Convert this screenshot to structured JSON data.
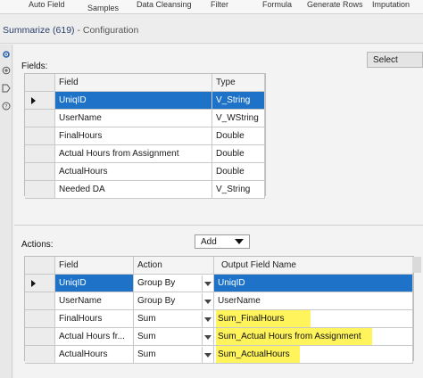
{
  "ribbon": {
    "items": [
      "Auto Field",
      "Samples",
      "Data Cleansing",
      "Filter",
      "Formula",
      "Generate Rows",
      "Imputation"
    ]
  },
  "header": {
    "tool": "Summarize (619)",
    "subtitle": " - Configuration"
  },
  "select_button": "Select",
  "fields": {
    "label": "Fields:",
    "columns": [
      "Field",
      "Type"
    ],
    "rows": [
      {
        "field": "UniqID",
        "type": "V_String",
        "selected": true
      },
      {
        "field": "UserName",
        "type": "V_WString"
      },
      {
        "field": "FinalHours",
        "type": "Double"
      },
      {
        "field": "Actual Hours from Assignment",
        "type": "Double"
      },
      {
        "field": "ActualHours",
        "type": "Double"
      },
      {
        "field": "Needed DA",
        "type": "V_String"
      }
    ]
  },
  "actions": {
    "label": "Actions:",
    "add_button": "Add",
    "columns": [
      "Field",
      "Action",
      "Output Field Name"
    ],
    "rows": [
      {
        "field": "UniqID",
        "action": "Group By",
        "output": "UniqID",
        "selected": true
      },
      {
        "field": "UserName",
        "action": "Group By",
        "output": "UserName"
      },
      {
        "field": "FinalHours",
        "action": "Sum",
        "output": "Sum_FinalHours",
        "highlight": true
      },
      {
        "field": "Actual Hours fr...",
        "action": "Sum",
        "output": "Sum_Actual Hours from Assignment",
        "highlight": true
      },
      {
        "field": "ActualHours",
        "action": "Sum",
        "output": "Sum_ActualHours",
        "highlight": true
      }
    ]
  },
  "colors": {
    "selection": "#1e73c8",
    "highlight": "#fff45c"
  },
  "icons": [
    "settings-icon",
    "view-icon",
    "tag-icon",
    "help-icon"
  ]
}
